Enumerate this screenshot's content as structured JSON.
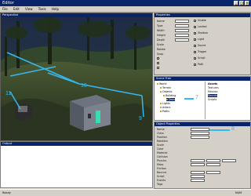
{
  "window": {
    "title": "Editor"
  },
  "menu": [
    "File",
    "Edit",
    "View",
    "Tools",
    "Help"
  ],
  "viewport": {
    "title": "Perspective",
    "callouts": [
      "10",
      "11",
      "9"
    ],
    "colors": {
      "callout": "#35b8f0",
      "sky": "#16223a",
      "ground": "#3a4a2a"
    }
  },
  "panelA": {
    "title": "Properties",
    "rows": [
      "Name",
      "Type",
      "Width",
      "Height",
      "Depth",
      "Scale",
      "Rotate",
      "Snap"
    ],
    "right_rows": [
      "Visible",
      "Locked",
      "Shadow",
      "Light",
      "Sound",
      "Trigger",
      "Script",
      "Path"
    ]
  },
  "explorer": {
    "title": "Scene Tree",
    "nodes": [
      "World",
      "Terrain",
      "Objects",
      "Building",
      "Door",
      "Lights",
      "Actors",
      "Paths"
    ],
    "right_title": "Assets",
    "right_items": [
      "Textures",
      "Meshes",
      "Sounds",
      "Scripts"
    ],
    "callout": "7"
  },
  "props": {
    "title": "Object Properties",
    "callout": "8",
    "fields": [
      "Name",
      "Class",
      "Position",
      "Rotation",
      "Scale",
      "Color",
      "Material",
      "Collision",
      "Physics",
      "Mass",
      "Friction",
      "Bounce",
      "Script",
      "Events",
      "Tags"
    ]
  },
  "output": {
    "title": "Output"
  },
  "status": {
    "left": "Ready",
    "right": "NUM"
  }
}
